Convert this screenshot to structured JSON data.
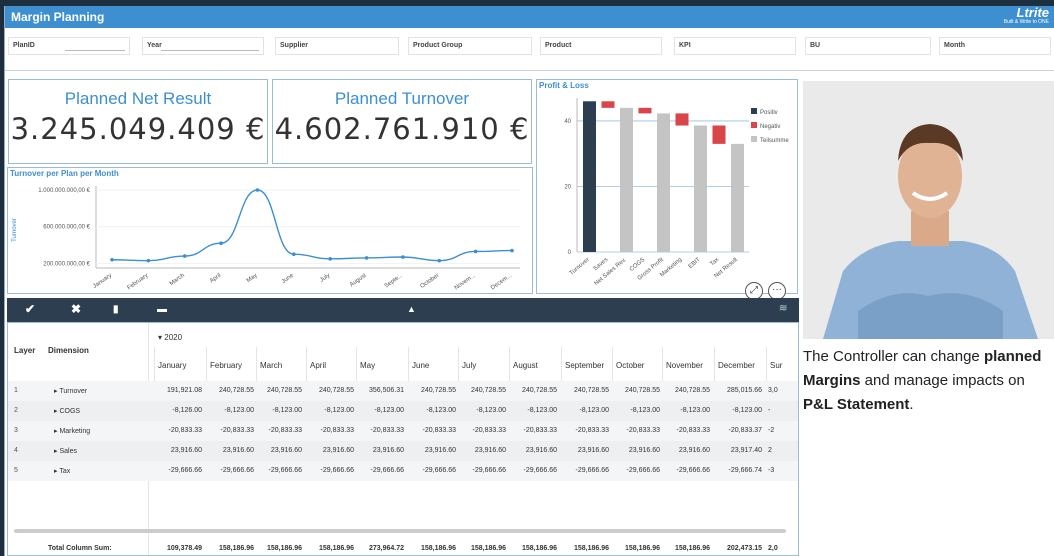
{
  "app": {
    "title": "Margin Planning",
    "logo": "Ltrite",
    "logo_sub": "Built & Write to ONE"
  },
  "filters": [
    "PlanID",
    "Year",
    "Supplier",
    "Product Group",
    "Product",
    "KPI",
    "BU",
    "Month"
  ],
  "kpis": [
    {
      "label": "Planned Net Result",
      "value": "3.245.049.409 €"
    },
    {
      "label": "Planned Turnover",
      "value": "4.602.761.910 €"
    }
  ],
  "turnover_chart": {
    "title": "Turnover per Plan per Month",
    "ylabel": "Turnover",
    "chart_data": {
      "type": "line",
      "categories": [
        "January",
        "February",
        "March",
        "April",
        "May",
        "June",
        "July",
        "August",
        "Septe...",
        "October",
        "Novem...",
        "Decem..."
      ],
      "y_tick_labels": [
        "1.000.000.000,00 €",
        "600.000.000,00 €",
        "200.000.000,00 €"
      ],
      "y_ticks": [
        1000000000,
        600000000,
        200000000
      ],
      "ylim": [
        150000000,
        1000000000
      ],
      "values": [
        240000000,
        230000000,
        280000000,
        420000000,
        1000000000,
        300000000,
        250000000,
        260000000,
        270000000,
        230000000,
        330000000,
        340000000
      ]
    }
  },
  "pnl_chart": {
    "title": "Profit & Loss",
    "chart_data": {
      "type": "bar",
      "categories": [
        "Turnover",
        "Saves",
        "Net Sales Rev.",
        "COGS",
        "Gross Profit",
        "Marketing",
        "EBIT",
        "Tax",
        "Net Result"
      ],
      "y_ticks": [
        0,
        20,
        40
      ],
      "ylim": [
        0,
        47
      ],
      "bars": [
        {
          "kind": "Positiv",
          "from": 0,
          "to": 46
        },
        {
          "kind": "Negativ",
          "from": 46,
          "to": 44
        },
        {
          "kind": "Teilsumme",
          "from": 0,
          "to": 44
        },
        {
          "kind": "Negativ",
          "from": 44,
          "to": 42.3
        },
        {
          "kind": "Teilsumme",
          "from": 0,
          "to": 42.3
        },
        {
          "kind": "Negativ",
          "from": 42.3,
          "to": 38.6
        },
        {
          "kind": "Teilsumme",
          "from": 0,
          "to": 38.6
        },
        {
          "kind": "Negativ",
          "from": 38.6,
          "to": 33
        },
        {
          "kind": "Teilsumme",
          "from": 0,
          "to": 33
        }
      ],
      "legend": [
        {
          "name": "Positiv",
          "color": "#2c3e4f"
        },
        {
          "name": "Negativ",
          "color": "#d9464a"
        },
        {
          "name": "Teilsumme",
          "color": "#c4c4c4"
        }
      ]
    }
  },
  "toolbar": {
    "icons": [
      "check-icon",
      "close-icon",
      "folder-open-icon",
      "folder-icon",
      "layers-icon"
    ]
  },
  "table": {
    "layer_header": "Layer",
    "dimension_header": "Dimension",
    "year": "2020",
    "months": [
      "January",
      "February",
      "March",
      "April",
      "May",
      "June",
      "July",
      "August",
      "September",
      "October",
      "November",
      "December",
      "Sur"
    ],
    "rows": [
      {
        "layer": "1",
        "dim": "Turnover",
        "vals": [
          "191,921.08",
          "240,728.55",
          "240,728.55",
          "240,728.55",
          "356,506.31",
          "240,728.55",
          "240,728.55",
          "240,728.55",
          "240,728.55",
          "240,728.55",
          "240,728.55",
          "285,015.66",
          "3,0"
        ]
      },
      {
        "layer": "2",
        "dim": "COGS",
        "vals": [
          "-8,126.00",
          "-8,123.00",
          "-8,123.00",
          "-8,123.00",
          "-8,123.00",
          "-8,123.00",
          "-8,123.00",
          "-8,123.00",
          "-8,123.00",
          "-8,123.00",
          "-8,123.00",
          "-8,123.00",
          "-"
        ]
      },
      {
        "layer": "3",
        "dim": "Marketing",
        "vals": [
          "-20,833.33",
          "-20,833.33",
          "-20,833.33",
          "-20,833.33",
          "-20,833.33",
          "-20,833.33",
          "-20,833.33",
          "-20,833.33",
          "-20,833.33",
          "-20,833.33",
          "-20,833.33",
          "-20,833.37",
          "-2"
        ]
      },
      {
        "layer": "4",
        "dim": "Sales",
        "vals": [
          "23,916.60",
          "23,916.60",
          "23,916.60",
          "23,916.60",
          "23,916.60",
          "23,916.60",
          "23,916.60",
          "23,916.60",
          "23,916.60",
          "23,916.60",
          "23,916.60",
          "23,917.40",
          "2"
        ]
      },
      {
        "layer": "5",
        "dim": "Tax",
        "vals": [
          "-29,666.66",
          "-29,666.66",
          "-29,666.66",
          "-29,666.66",
          "-29,666.66",
          "-29,666.66",
          "-29,666.66",
          "-29,666.66",
          "-29,666.66",
          "-29,666.66",
          "-29,666.66",
          "-29,666.74",
          "-3"
        ]
      }
    ],
    "total_label": "Total Column Sum:",
    "totals": [
      "109,378.49",
      "158,186.96",
      "158,186.96",
      "158,186.96",
      "273,964.72",
      "158,186.96",
      "158,186.96",
      "158,186.96",
      "158,186.96",
      "158,186.96",
      "158,186.96",
      "202,473.15",
      "2,0"
    ]
  },
  "side": {
    "caption_1": "The Controller can change ",
    "caption_bold_1": "planned Margins",
    "caption_2": " and manage impacts on ",
    "caption_bold_2": "P&L Statement",
    "caption_3": "."
  },
  "colors": {
    "accent": "#3d8fd0",
    "dark": "#2c3e4f",
    "negative": "#d9464a",
    "subtotal": "#c4c4c4"
  }
}
